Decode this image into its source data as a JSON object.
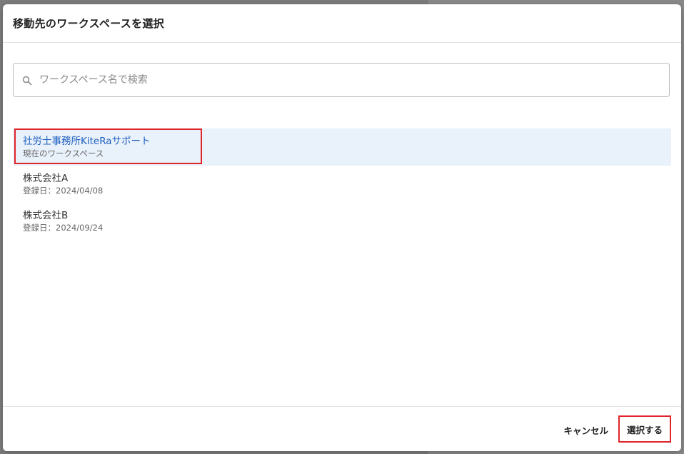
{
  "modal": {
    "title": "移動先のワークスペースを選択"
  },
  "search": {
    "placeholder": "ワークスペース名で検索",
    "value": ""
  },
  "workspaces": [
    {
      "name": "社労士事務所KiteRaサポート",
      "sub": "現在のワークスペース",
      "current": true
    },
    {
      "name": "株式会社A",
      "sub": "登録日：2024/04/08",
      "current": false
    },
    {
      "name": "株式会社B",
      "sub": "登録日：2024/09/24",
      "current": false
    }
  ],
  "footer": {
    "cancel_label": "キャンセル",
    "select_label": "選択する"
  },
  "colors": {
    "accent": "#1f5fbf",
    "selected_bg": "#e9f1fb",
    "highlight": "#e0242a"
  },
  "icons": {
    "search": "search-icon"
  }
}
